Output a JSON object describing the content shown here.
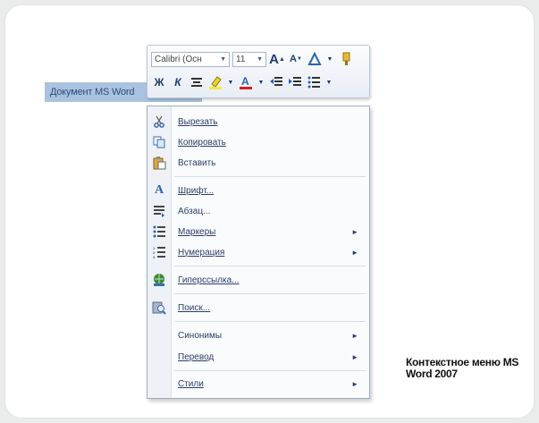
{
  "document": {
    "selected_text": "Документ MS Word"
  },
  "mini_toolbar": {
    "font_name": "Calibri (Осн",
    "font_size": "11",
    "grow_font": "A",
    "shrink_font": "A",
    "bold": "Ж",
    "italic": "К"
  },
  "context_menu": {
    "items": [
      {
        "label": "Вырезать"
      },
      {
        "label": "Копировать"
      },
      {
        "label": "Вставить"
      },
      {
        "label": "Шрифт..."
      },
      {
        "label": "Абзац..."
      },
      {
        "label": "Маркеры"
      },
      {
        "label": "Нумерация"
      },
      {
        "label": "Гиперссылка..."
      },
      {
        "label": "Поиск..."
      },
      {
        "label": "Синонимы"
      },
      {
        "label": "Перевод"
      },
      {
        "label": "Стили"
      }
    ]
  },
  "caption": "Контекстное меню MS Word 2007"
}
